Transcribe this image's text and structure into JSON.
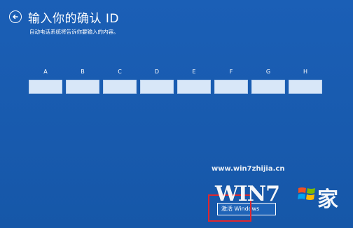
{
  "header": {
    "back_icon": "back-arrow-icon",
    "title": "输入你的确认 ID",
    "subtitle": "自动电话系统将告诉你要输入的内容。"
  },
  "confirmation_id": {
    "groups": [
      {
        "label": "A",
        "value": ""
      },
      {
        "label": "B",
        "value": ""
      },
      {
        "label": "C",
        "value": ""
      },
      {
        "label": "D",
        "value": ""
      },
      {
        "label": "E",
        "value": ""
      },
      {
        "label": "F",
        "value": ""
      },
      {
        "label": "G",
        "value": ""
      },
      {
        "label": "H",
        "value": ""
      }
    ]
  },
  "footer": {
    "activate_label": "激活 Windows"
  },
  "watermark": {
    "url": "www.win7zhijia.cn",
    "logo_text": "WIN7",
    "logo_suffix": "家",
    "logo_icon": "windows-flag-icon"
  },
  "colors": {
    "background": "#1a5cb0",
    "field": "#d8e7f8",
    "highlight": "#e0262d"
  }
}
